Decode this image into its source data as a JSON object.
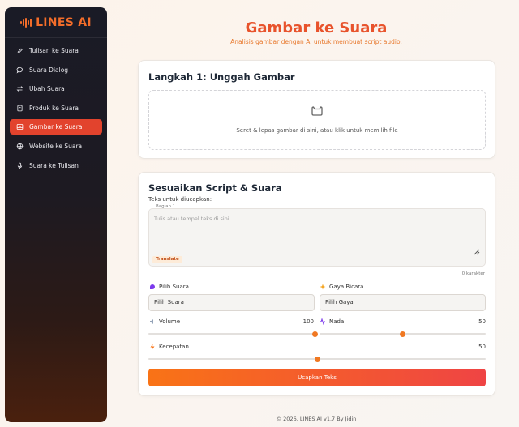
{
  "brand": {
    "name": "LINES AI",
    "color": "#f36d2a"
  },
  "sidebar": {
    "items": [
      {
        "label": "Tulisan ke Suara",
        "icon": "edit-icon",
        "active": false
      },
      {
        "label": "Suara Dialog",
        "icon": "chat-bubble-icon",
        "active": false
      },
      {
        "label": "Ubah Suara",
        "icon": "swap-icon",
        "active": false
      },
      {
        "label": "Produk ke Suara",
        "icon": "document-icon",
        "active": false
      },
      {
        "label": "Gambar ke Suara",
        "icon": "image-icon",
        "active": true
      },
      {
        "label": "Website ke Suara",
        "icon": "globe-icon",
        "active": false
      },
      {
        "label": "Suara ke Tulisan",
        "icon": "microphone-icon",
        "active": false
      }
    ]
  },
  "page": {
    "title": "Gambar ke Suara",
    "subtitle": "Analisis gambar dengan AI untuk membuat script audio."
  },
  "upload": {
    "title": "Langkah 1: Unggah Gambar",
    "hint": "Seret & lepas gambar di sini, atau klik untuk memilih file",
    "icon": "image-upload-icon"
  },
  "script": {
    "title": "Sesuaikan Script & Suara",
    "text_label": "Teks untuk diucapkan:",
    "section_label": "Bagian 1",
    "placeholder": "Tulis atau tempel teks di sini...",
    "translate_label": "Translate",
    "char_count": "0 karakter",
    "voice": {
      "label": "Pilih Suara",
      "value": "Pilih Suara",
      "icon": "voice-icon"
    },
    "style": {
      "label": "Gaya Bicara",
      "value": "Pilih Gaya",
      "icon": "sparkle-icon"
    },
    "volume": {
      "label": "Volume",
      "value": "100",
      "level": 1.0,
      "icon": "speaker-icon"
    },
    "pitch": {
      "label": "Nada",
      "value": "50",
      "level": 0.5,
      "icon": "waveform-icon"
    },
    "speed": {
      "label": "Kecepatan",
      "value": "50",
      "level": 0.5,
      "icon": "lightning-icon"
    },
    "submit_label": "Ucapkan Teks"
  },
  "footer": {
    "text": "© 2026. LINES AI v1.7 By Jidin"
  },
  "colors": {
    "accent": "#e8532c",
    "active_nav": "#e2432d",
    "slider": "#f07822"
  }
}
